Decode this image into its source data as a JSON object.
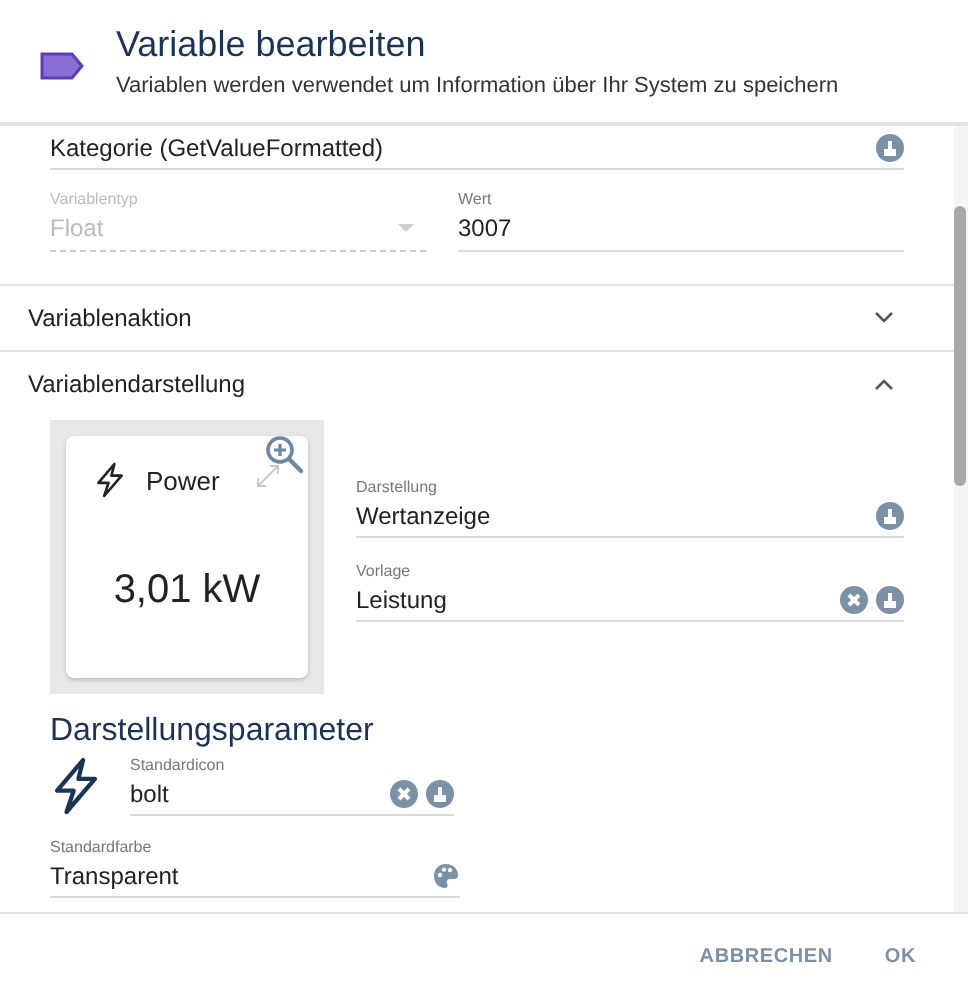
{
  "dialog": {
    "title": "Variable bearbeiten",
    "subtitle": "Variablen werden verwendet um Information über Ihr System zu speichern"
  },
  "category_field": {
    "value": "Kategorie (GetValueFormatted)",
    "selectable": true
  },
  "type_field": {
    "label": "Variablentyp",
    "value": "Float",
    "disabled": true
  },
  "value_field": {
    "label": "Wert",
    "value": "3007"
  },
  "sections": [
    {
      "title": "Variablenaktion",
      "expanded": false
    },
    {
      "title": "Variablendarstellung",
      "expanded": true
    }
  ],
  "preview": {
    "name": "Power",
    "value": "3,01 kW"
  },
  "presentation_fields": [
    {
      "label": "Darstellung",
      "value": "Wertanzeige",
      "clearable": false,
      "selectable": true
    },
    {
      "label": "Vorlage",
      "value": "Leistung",
      "clearable": true,
      "selectable": true
    }
  ],
  "parameters": {
    "heading": "Darstellungsparameter",
    "icon_field": {
      "label": "Standardicon",
      "value": "bolt",
      "clearable": true,
      "selectable": true
    },
    "color_field": {
      "label": "Standardfarbe",
      "value": "Transparent",
      "color_picker": true
    }
  },
  "buttons": [
    "ABBRECHEN",
    "OK"
  ]
}
